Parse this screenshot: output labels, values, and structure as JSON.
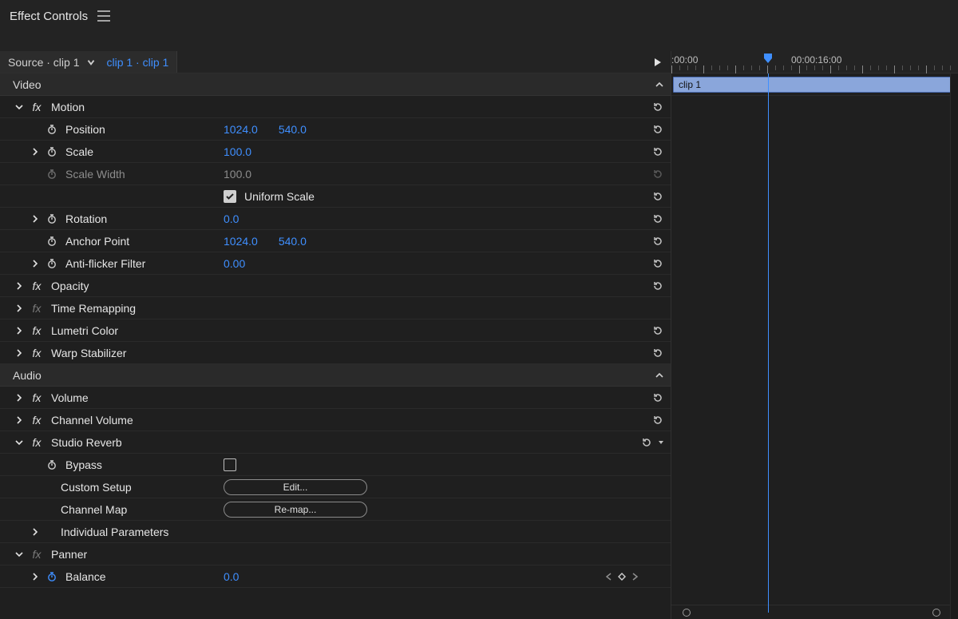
{
  "header": {
    "title": "Effect Controls"
  },
  "source": {
    "label": "Source · clip 1",
    "sequence_path": "clip 1 · clip 1"
  },
  "sections": {
    "video": {
      "label": "Video"
    },
    "audio": {
      "label": "Audio"
    }
  },
  "effects": {
    "motion": {
      "name": "Motion",
      "expanded": true,
      "params": {
        "position": {
          "name": "Position",
          "x": "1024.0",
          "y": "540.0"
        },
        "scale": {
          "name": "Scale",
          "value": "100.0"
        },
        "scale_width": {
          "name": "Scale Width",
          "value": "100.0",
          "disabled": true
        },
        "uniform_scale": {
          "name": "Uniform Scale",
          "checked": true
        },
        "rotation": {
          "name": "Rotation",
          "value": "0.0"
        },
        "anchor": {
          "name": "Anchor Point",
          "x": "1024.0",
          "y": "540.0"
        },
        "anti_flicker": {
          "name": "Anti-flicker Filter",
          "value": "0.00"
        }
      }
    },
    "opacity": {
      "name": "Opacity",
      "expanded": false
    },
    "time_remapping": {
      "name": "Time Remapping",
      "expanded": false,
      "fx_dim": true
    },
    "lumetri_color": {
      "name": "Lumetri Color",
      "expanded": false
    },
    "warp_stabilizer": {
      "name": "Warp Stabilizer",
      "expanded": false
    },
    "volume": {
      "name": "Volume",
      "expanded": false
    },
    "channel_volume": {
      "name": "Channel Volume",
      "expanded": false
    },
    "studio_reverb": {
      "name": "Studio Reverb",
      "expanded": true,
      "params": {
        "bypass": {
          "name": "Bypass",
          "checked": false
        },
        "custom_setup": {
          "name": "Custom Setup",
          "button": "Edit..."
        },
        "channel_map": {
          "name": "Channel Map",
          "button": "Re-map..."
        },
        "individual": {
          "name": "Individual Parameters"
        }
      }
    },
    "panner": {
      "name": "Panner",
      "expanded": true,
      "fx_dim": true,
      "params": {
        "balance": {
          "name": "Balance",
          "value": "0.0",
          "animated": true
        }
      }
    }
  },
  "timeline": {
    "tc_start": ":00:00",
    "tc_mid": "00:00:16:00",
    "clip_label": "clip 1",
    "tick_count": 36,
    "major_every": 4
  },
  "colors": {
    "accent_blue": "#3f8fff",
    "clip_fill": "#8aa6db",
    "bg_panel": "#232323",
    "bg_body": "#1f1f1f"
  }
}
